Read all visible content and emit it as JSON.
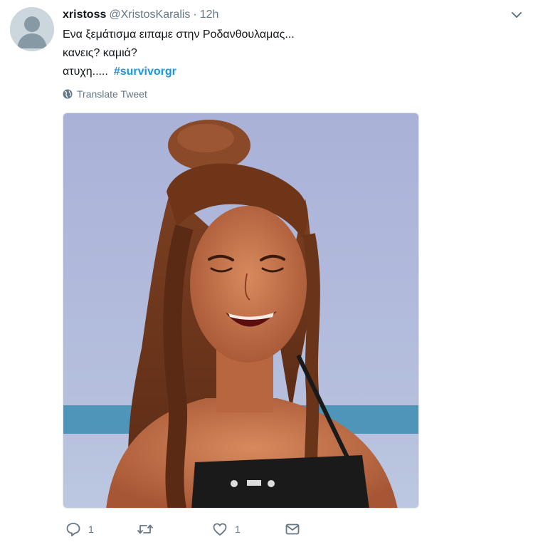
{
  "tweet": {
    "fullname": "xristoss",
    "username": "@XristosKaralis",
    "separator": "·",
    "time": "12h",
    "lines": [
      "Ενα ξεμάτισμα ειπαμε στην Ροδανθουλαμας...",
      "κανεις? καμιά?",
      "ατυχη....."
    ],
    "hashtag": "#survivorgr",
    "translate_label": "Translate Tweet"
  },
  "actions": {
    "reply_count": "1",
    "retweet_count": "",
    "like_count": "1"
  },
  "colors": {
    "link": "#1b95e0",
    "secondary_text": "#657786",
    "primary_text": "#14171a",
    "avatar_bg": "#ccd6dd"
  },
  "icons": [
    "default-avatar-icon",
    "chevron-down-icon",
    "globe-icon",
    "reply-icon",
    "retweet-icon",
    "heart-icon",
    "message-icon"
  ]
}
